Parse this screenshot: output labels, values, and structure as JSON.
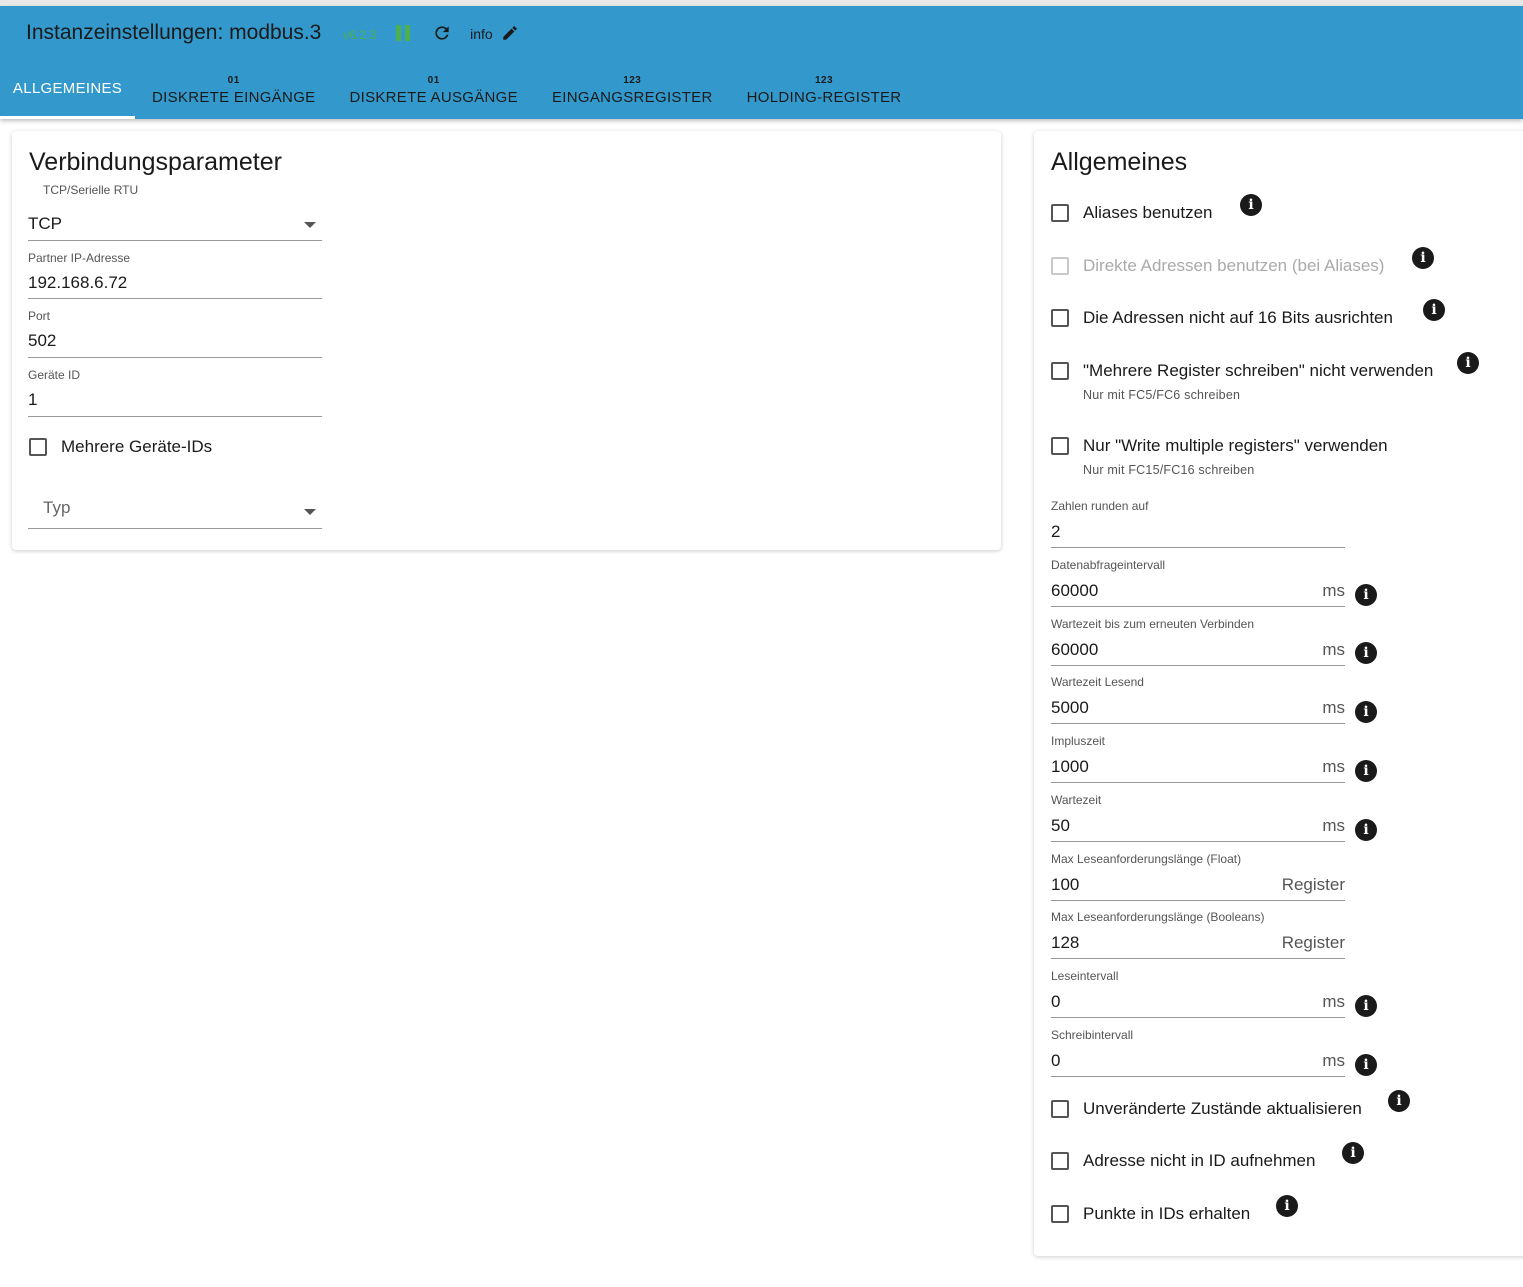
{
  "header": {
    "title": "Instanzeinstellungen: modbus.3",
    "version": "v6.2.3",
    "info_label": "info",
    "icons": {
      "pause": "pause-icon",
      "reload": "reload-icon",
      "edit": "pencil-icon"
    },
    "colors": {
      "bar": "#3399cc",
      "running": "#4caf50"
    }
  },
  "tabs": [
    {
      "label": "ALLGEMEINES",
      "icon": "",
      "active": true
    },
    {
      "label": "DISKRETE EINGÄNGE",
      "icon": "01"
    },
    {
      "label": "DISKRETE AUSGÄNGE",
      "icon": "01"
    },
    {
      "label": "EINGANGSREGISTER",
      "icon": "123"
    },
    {
      "label": "HOLDING-REGISTER",
      "icon": "123"
    }
  ],
  "connection": {
    "title": "Verbindungsparameter",
    "mode": {
      "label": "TCP/Serielle RTU",
      "value": "TCP"
    },
    "ip": {
      "label": "Partner IP-Adresse",
      "value": "192.168.6.72"
    },
    "port": {
      "label": "Port",
      "value": "502"
    },
    "device_id": {
      "label": "Geräte ID",
      "value": "1"
    },
    "multi_ids": {
      "label": "Mehrere Geräte-IDs",
      "checked": false
    },
    "type": {
      "placeholder": "Typ",
      "value": ""
    }
  },
  "general": {
    "title": "Allgemeines",
    "checkboxes_top": [
      {
        "label": "Aliases benutzen",
        "help": "",
        "checked": false,
        "disabled": false
      },
      {
        "label": "Direkte Adressen benutzen (bei Aliases)",
        "help": "",
        "checked": false,
        "disabled": true
      },
      {
        "label": "Die Adressen nicht auf 16 Bits ausrichten",
        "help": "",
        "checked": false,
        "disabled": false
      },
      {
        "label": "\"Mehrere Register schreiben\" nicht verwenden",
        "help": "Nur mit FC5/FC6 schreiben",
        "checked": false,
        "disabled": false
      },
      {
        "label": "Nur \"Write multiple registers\" verwenden",
        "help": "Nur mit FC15/FC16 schreiben",
        "checked": false,
        "disabled": false
      }
    ],
    "fields": [
      {
        "label": "Zahlen runden auf",
        "value": "2",
        "unit": ""
      },
      {
        "label": "Datenabfrageintervall",
        "value": "60000",
        "unit": "ms"
      },
      {
        "label": "Wartezeit bis zum erneuten Verbinden",
        "value": "60000",
        "unit": "ms"
      },
      {
        "label": "Wartezeit Lesend",
        "value": "5000",
        "unit": "ms"
      },
      {
        "label": "Impluszeit",
        "value": "1000",
        "unit": "ms"
      },
      {
        "label": "Wartezeit",
        "value": "50",
        "unit": "ms"
      },
      {
        "label": "Max Leseanforderungslänge (Float)",
        "value": "100",
        "unit": "Register"
      },
      {
        "label": "Max Leseanforderungslänge (Booleans)",
        "value": "128",
        "unit": "Register"
      },
      {
        "label": "Leseintervall",
        "value": "0",
        "unit": "ms"
      },
      {
        "label": "Schreibintervall",
        "value": "0",
        "unit": "ms"
      }
    ],
    "checkboxes_bottom": [
      {
        "label": "Unveränderte Zustände aktualisieren",
        "checked": false
      },
      {
        "label": "Adresse nicht in ID aufnehmen",
        "checked": false
      },
      {
        "label": "Punkte in IDs erhalten",
        "checked": false
      }
    ]
  }
}
